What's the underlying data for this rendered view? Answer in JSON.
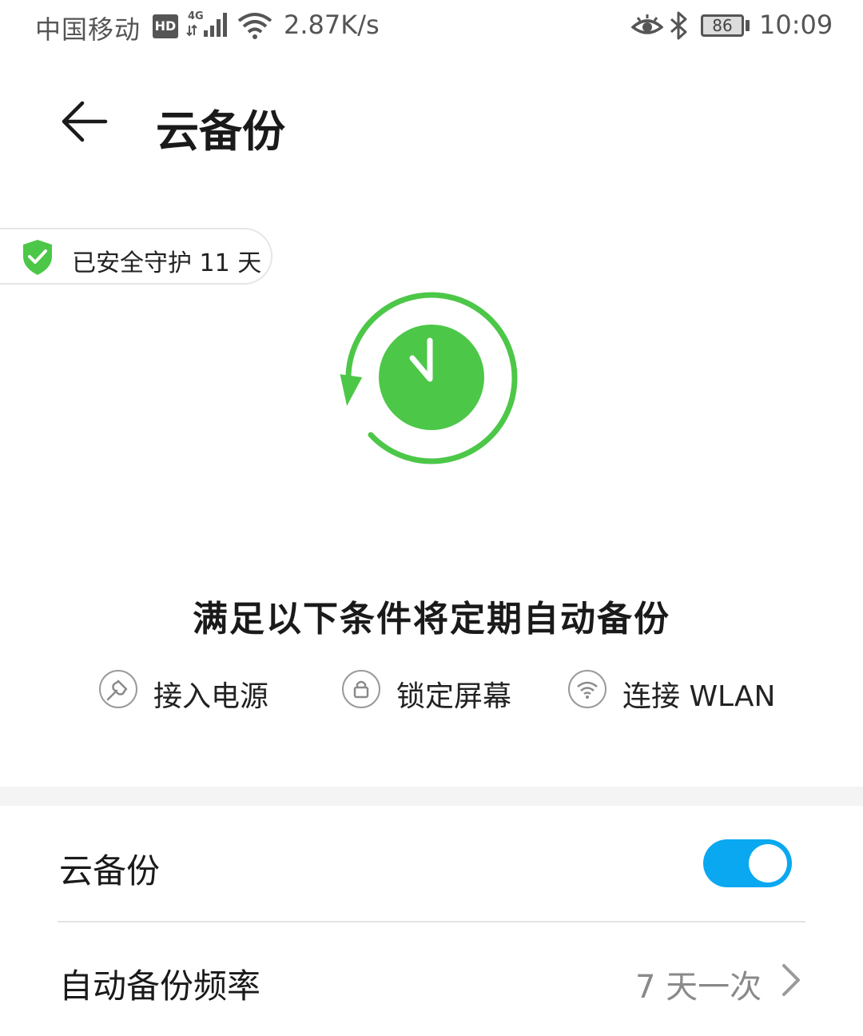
{
  "statusbar": {
    "carrier": "中国移动",
    "hd": "HD",
    "network": "4G",
    "speed": "2.87K/s",
    "battery": "86",
    "time": "10:09"
  },
  "header": {
    "title": "云备份"
  },
  "protection": {
    "text": "已安全守护 11 天",
    "color": "#4cc748"
  },
  "conditions": {
    "title": "满足以下条件将定期自动备份",
    "items": [
      {
        "label": "接入电源",
        "icon": "power-plug-icon"
      },
      {
        "label": "锁定屏幕",
        "icon": "lock-icon"
      },
      {
        "label": "连接 WLAN",
        "icon": "wifi-icon"
      }
    ]
  },
  "settings": {
    "cloud_backup": {
      "label": "云备份",
      "enabled": true,
      "toggle_color": "#0aa8f0"
    },
    "frequency": {
      "label": "自动备份频率",
      "value": "7 天一次"
    }
  }
}
